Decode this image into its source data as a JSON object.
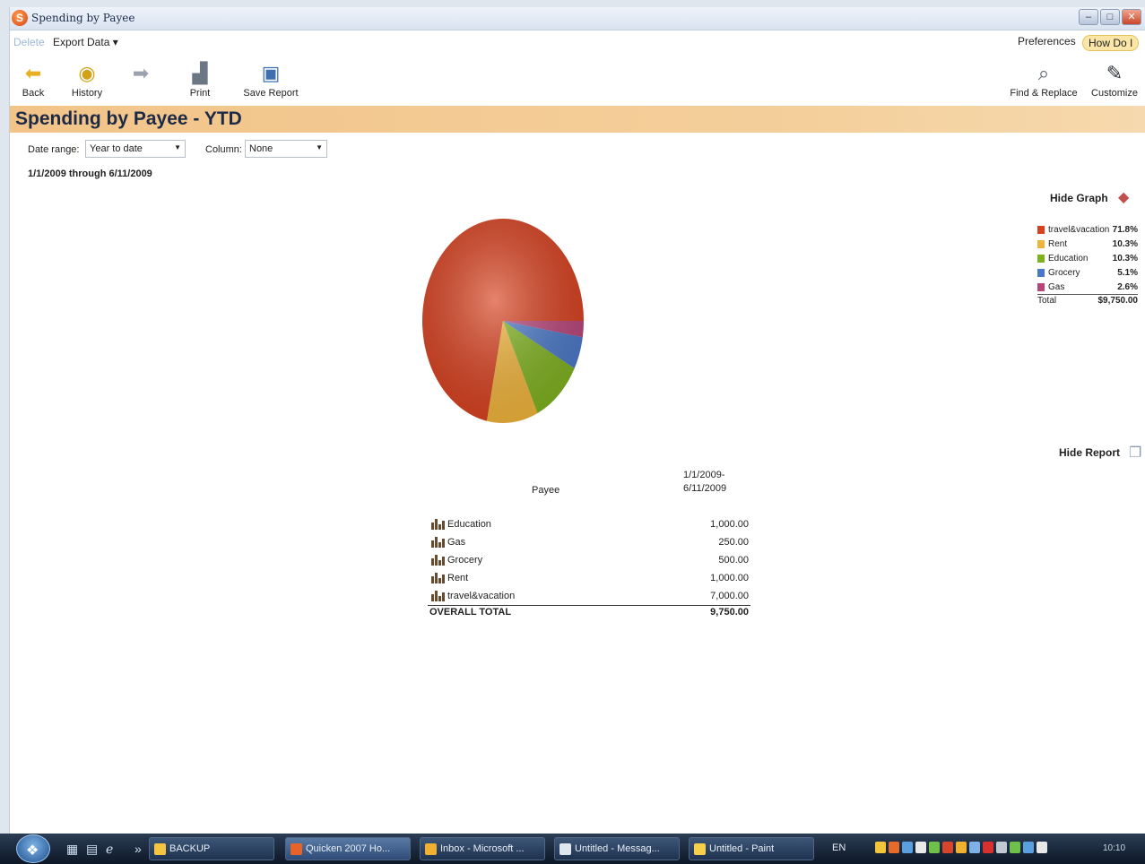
{
  "window": {
    "title": "Spending by Payee",
    "app_icon_letter": "S",
    "controls": [
      "–",
      "□",
      "✕"
    ]
  },
  "menu": {
    "left_faded": "Delete",
    "export": "Export Data ▾",
    "preferences": "Preferences",
    "how_do_i": "How Do I"
  },
  "toolbar": {
    "back": "Back",
    "history": "History",
    "print": "Print",
    "save_report": "Save Report",
    "find_replace": "Find & Replace",
    "customize": "Customize"
  },
  "report": {
    "title": "Spending by Payee - YTD",
    "date_range_label": "Date range:",
    "date_range_value": "Year to date",
    "column_label": "Column:",
    "column_value": "None",
    "date_range_text": "1/1/2009 through 6/11/2009",
    "header_payee": "Payee",
    "header_date_1": "1/1/2009-",
    "header_date_2": "6/11/2009",
    "rows": [
      {
        "name": "Education",
        "value": "1,000.00"
      },
      {
        "name": "Gas",
        "value": "250.00"
      },
      {
        "name": "Grocery",
        "value": "500.00"
      },
      {
        "name": "Rent",
        "value": "1,000.00"
      },
      {
        "name": "travel&vacation",
        "value": "7,000.00"
      }
    ],
    "total_label": "OVERALL TOTAL",
    "total_value": "9,750.00",
    "hide_report": "Hide Report"
  },
  "graph": {
    "hide_graph": "Hide Graph",
    "legend": [
      {
        "name": "travel&vacation",
        "pct": "71.8%",
        "color": "#d8401e"
      },
      {
        "name": "Rent",
        "pct": "10.3%",
        "color": "#f1b43a"
      },
      {
        "name": "Education",
        "pct": "10.3%",
        "color": "#7fb21f"
      },
      {
        "name": "Grocery",
        "pct": "5.1%",
        "color": "#4a78c8"
      },
      {
        "name": "Gas",
        "pct": "2.6%",
        "color": "#b8457a"
      }
    ],
    "total_label": "Total",
    "total_value": "$9,750.00"
  },
  "chart_data": {
    "type": "pie",
    "categories": [
      "travel&vacation",
      "Rent",
      "Education",
      "Grocery",
      "Gas"
    ],
    "values": [
      7000,
      1000,
      1000,
      500,
      250
    ],
    "colors": [
      "#d8401e",
      "#f1b43a",
      "#7fb21f",
      "#4a78c8",
      "#b8457a"
    ]
  },
  "taskbar": {
    "items": [
      {
        "label": "BACKUP",
        "color": "#f5c542"
      },
      {
        "label": "Quicken 2007 Ho...",
        "color": "#e8622a"
      },
      {
        "label": "Inbox - Microsoft ...",
        "color": "#f0b030"
      },
      {
        "label": "Untitled - Messag...",
        "color": "#e0e6ee"
      },
      {
        "label": "Untitled - Paint",
        "color": "#f6d04a"
      }
    ],
    "lang": "EN",
    "clock": "10:10"
  }
}
